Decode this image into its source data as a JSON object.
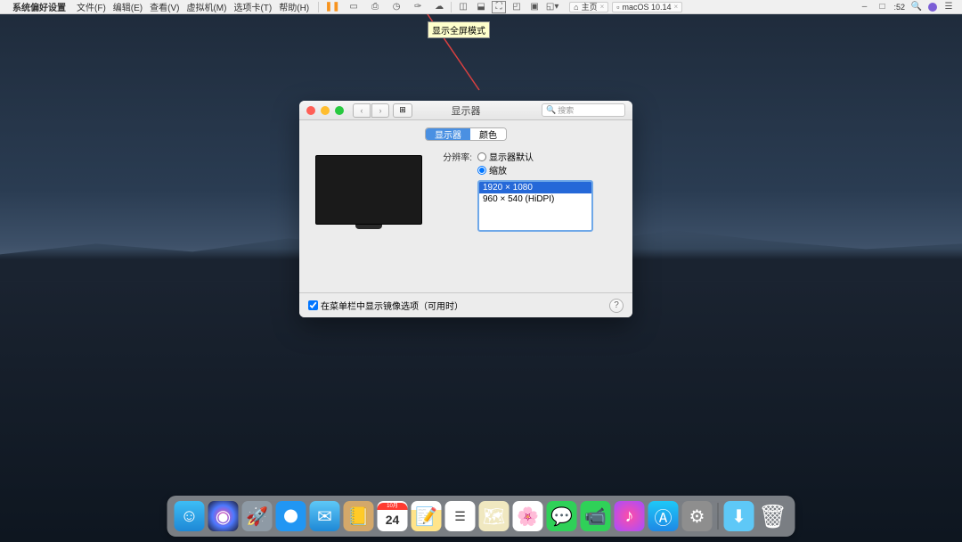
{
  "toolbar": {
    "apple_menu": "",
    "app_name": "系统偏好设置",
    "menus": [
      "文件(F)",
      "编辑(E)",
      "查看(V)",
      "虚拟机(M)",
      "选项卡(T)",
      "帮助(H)"
    ],
    "tabs": [
      {
        "icon": "home",
        "label": "主页"
      },
      {
        "icon": "mac",
        "label": "macOS 10.14"
      }
    ],
    "clock": ":52"
  },
  "tooltip": "显示全屏模式",
  "window": {
    "title": "显示器",
    "search_placeholder": "搜索",
    "tabs": {
      "display": "显示器",
      "color": "颜色"
    },
    "resolution_label": "分辨率:",
    "radio_default": "显示器默认",
    "radio_scaled": "缩放",
    "resolutions": [
      "1920 × 1080",
      "960 × 540 (HiDPI)"
    ],
    "footer_checkbox": "在菜单栏中显示镜像选项（可用时）",
    "help": "?"
  },
  "calendar": {
    "month": "10月",
    "day": "24"
  },
  "dock_names": [
    "finder",
    "siri",
    "launchpad",
    "safari",
    "mail",
    "contacts",
    "calendar",
    "notes",
    "reminders",
    "maps",
    "photos",
    "messages",
    "facetime",
    "itunes",
    "appstore",
    "syspref",
    "downloads",
    "trash"
  ]
}
